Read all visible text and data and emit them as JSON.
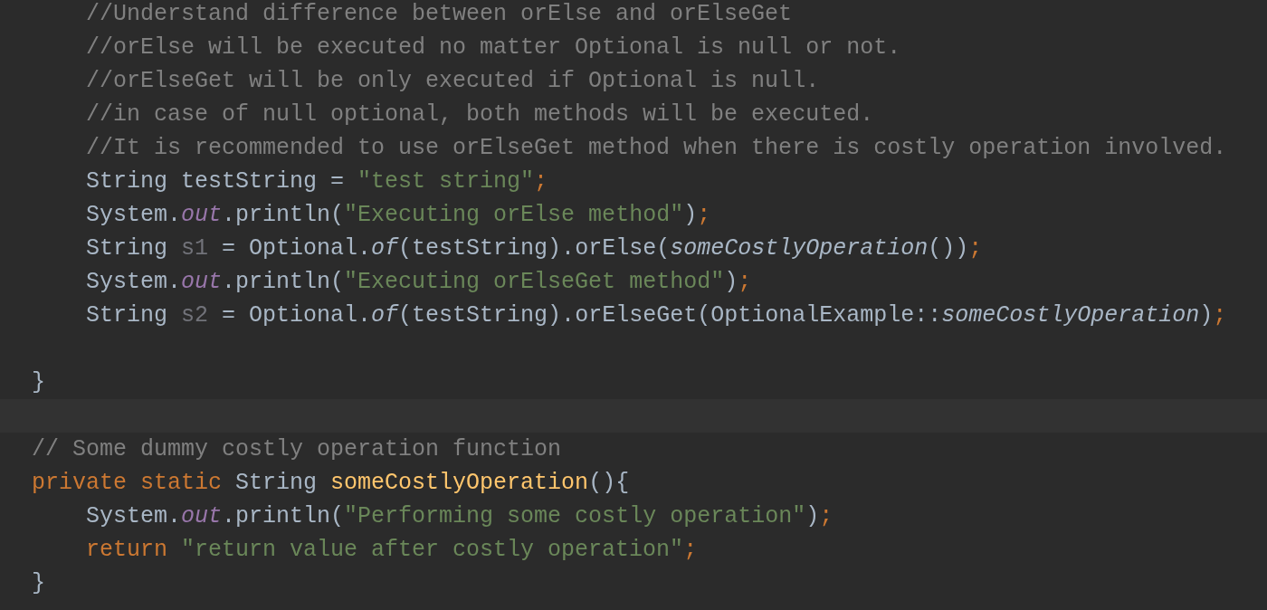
{
  "editor": {
    "lines": [
      {
        "kind": "group",
        "children": [
          {
            "kind": "code",
            "tokens": [
              {
                "kind": "comment",
                "text": "//Understand difference between orElse and orElseGet"
              }
            ]
          },
          {
            "kind": "code",
            "tokens": [
              {
                "kind": "comment",
                "text": "//orElse will be executed no matter Optional is null or not."
              }
            ]
          },
          {
            "kind": "code",
            "tokens": [
              {
                "kind": "comment",
                "text": "//orElseGet will be only executed if Optional is null."
              }
            ]
          },
          {
            "kind": "code",
            "tokens": [
              {
                "kind": "comment",
                "text": "//in case of null optional, both methods will be executed."
              }
            ]
          },
          {
            "kind": "code",
            "tokens": [
              {
                "kind": "comment",
                "text": "//It is recommended to use orElseGet method when there is costly operation involved."
              }
            ]
          },
          {
            "kind": "code",
            "tokens": [
              {
                "kind": "plain",
                "text": "String testString = "
              },
              {
                "kind": "string",
                "text": "\"test string\""
              },
              {
                "kind": "keyword",
                "text": ";"
              }
            ]
          },
          {
            "kind": "code",
            "tokens": [
              {
                "kind": "plain",
                "text": "System."
              },
              {
                "kind": "field",
                "text": "out"
              },
              {
                "kind": "plain",
                "text": ".println("
              },
              {
                "kind": "string",
                "text": "\"Executing orElse method\""
              },
              {
                "kind": "plain",
                "text": ")"
              },
              {
                "kind": "keyword",
                "text": ";"
              }
            ]
          },
          {
            "kind": "code",
            "tokens": [
              {
                "kind": "plain",
                "text": "String "
              },
              {
                "kind": "unused",
                "text": "s1"
              },
              {
                "kind": "plain",
                "text": " = Optional."
              },
              {
                "kind": "static",
                "text": "of"
              },
              {
                "kind": "plain",
                "text": "(testString).orElse("
              },
              {
                "kind": "static",
                "text": "someCostlyOperation"
              },
              {
                "kind": "plain",
                "text": "())"
              },
              {
                "kind": "keyword",
                "text": ";"
              }
            ]
          },
          {
            "kind": "code",
            "tokens": [
              {
                "kind": "plain",
                "text": "System."
              },
              {
                "kind": "field",
                "text": "out"
              },
              {
                "kind": "plain",
                "text": ".println("
              },
              {
                "kind": "string",
                "text": "\"Executing orElseGet method\""
              },
              {
                "kind": "plain",
                "text": ")"
              },
              {
                "kind": "keyword",
                "text": ";"
              }
            ]
          },
          {
            "kind": "code",
            "tokens": [
              {
                "kind": "plain",
                "text": "String "
              },
              {
                "kind": "unused",
                "text": "s2"
              },
              {
                "kind": "plain",
                "text": " = Optional."
              },
              {
                "kind": "static",
                "text": "of"
              },
              {
                "kind": "plain",
                "text": "(testString).orElseGet(OptionalExample::"
              },
              {
                "kind": "static",
                "text": "someCostlyOperation"
              },
              {
                "kind": "plain",
                "text": ")"
              },
              {
                "kind": "keyword",
                "text": ";"
              }
            ]
          }
        ]
      },
      {
        "kind": "blank"
      },
      {
        "kind": "code",
        "tokens": [
          {
            "kind": "plain",
            "text": "}"
          }
        ]
      },
      {
        "kind": "caret-line"
      },
      {
        "kind": "code",
        "tokens": [
          {
            "kind": "comment",
            "text": "// Some dummy costly operation function"
          }
        ]
      },
      {
        "kind": "code",
        "tokens": [
          {
            "kind": "keyword",
            "text": "private static "
          },
          {
            "kind": "plain",
            "text": "String "
          },
          {
            "kind": "method",
            "text": "someCostlyOperation"
          },
          {
            "kind": "plain",
            "text": "(){"
          }
        ],
        "children": [
          {
            "kind": "code",
            "tokens": [
              {
                "kind": "plain",
                "text": "System."
              },
              {
                "kind": "field",
                "text": "out"
              },
              {
                "kind": "plain",
                "text": ".println("
              },
              {
                "kind": "string",
                "text": "\"Performing some costly operation\""
              },
              {
                "kind": "plain",
                "text": ")"
              },
              {
                "kind": "keyword",
                "text": ";"
              }
            ]
          },
          {
            "kind": "code",
            "tokens": [
              {
                "kind": "keyword",
                "text": "return "
              },
              {
                "kind": "string",
                "text": "\"return value after costly operation\""
              },
              {
                "kind": "keyword",
                "text": ";"
              }
            ]
          }
        ]
      },
      {
        "kind": "code",
        "tokens": [
          {
            "kind": "plain",
            "text": "}"
          }
        ]
      }
    ]
  }
}
